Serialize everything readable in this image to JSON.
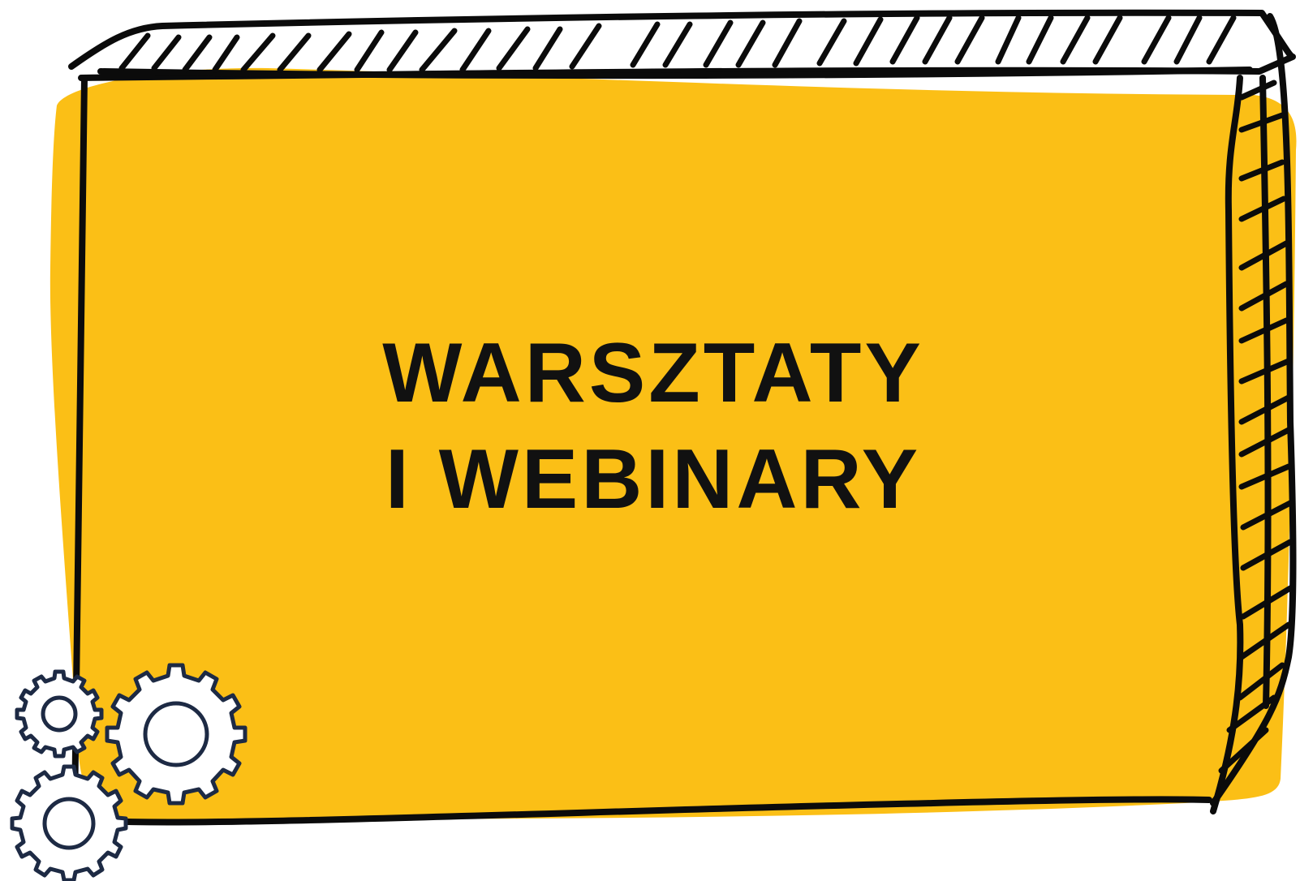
{
  "banner": {
    "title_line_1": "WARSZTATY",
    "title_line_2": "I WEBINARY"
  },
  "colors": {
    "panel_fill": "#fbbf16",
    "frame_stroke": "#0b0b0b",
    "gear_stroke": "#1d2a44",
    "background": "#ffffff"
  },
  "icons": [
    "gears-icon"
  ]
}
